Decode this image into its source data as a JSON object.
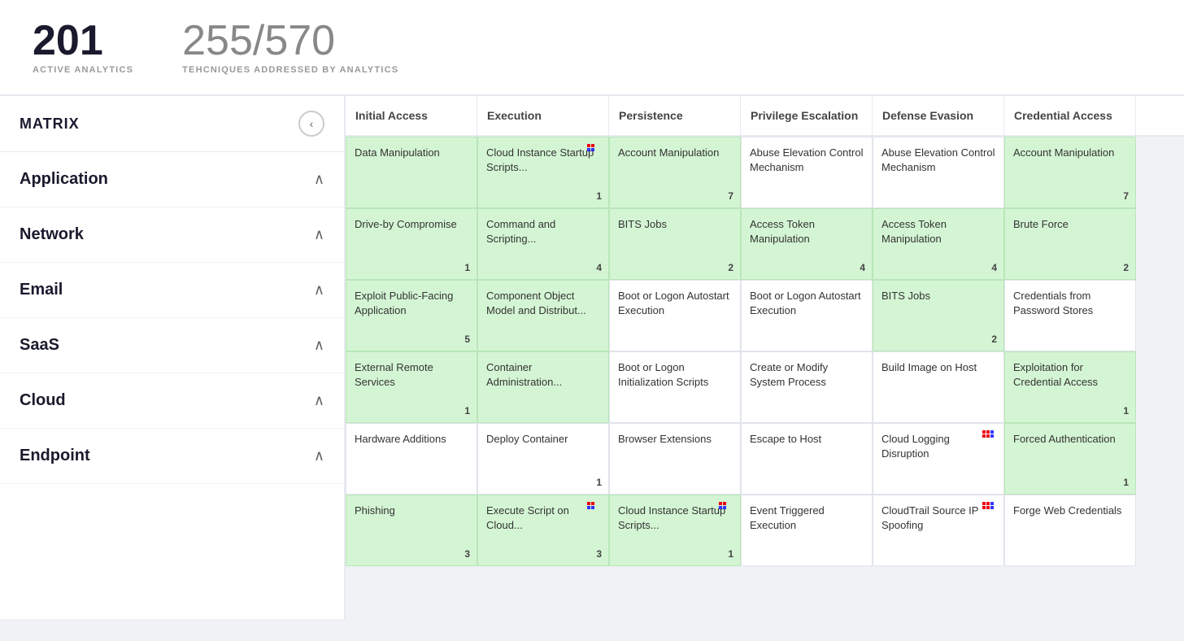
{
  "topbar": {
    "active_analytics": "201",
    "active_analytics_label": "ACTIVE ANALYTICS",
    "techniques_count": "255",
    "techniques_total": "/570",
    "techniques_label": "TEHCNIQUES ADDRESSED BY ANALYTICS"
  },
  "sidebar": {
    "title": "MATRIX",
    "items": [
      {
        "label": "Application"
      },
      {
        "label": "Network"
      },
      {
        "label": "Email"
      },
      {
        "label": "SaaS"
      },
      {
        "label": "Cloud"
      },
      {
        "label": "Endpoint"
      }
    ]
  },
  "matrix": {
    "columns": [
      "Initial Access",
      "Execution",
      "Persistence",
      "Privilege Escalation",
      "Defense Evasion",
      "Credential Access"
    ],
    "rows": [
      [
        {
          "text": "Data Manipulation",
          "style": "green",
          "badge": "",
          "icon": false
        },
        {
          "text": "Cloud Instance Startup Scripts...",
          "style": "green",
          "badge": "1",
          "icon": true,
          "icon_type": "mixed"
        },
        {
          "text": "Account Manipulation",
          "style": "green",
          "badge": "7",
          "icon": false
        },
        {
          "text": "Abuse Elevation Control Mechanism",
          "style": "",
          "badge": "",
          "icon": false
        },
        {
          "text": "Abuse Elevation Control Mechanism",
          "style": "",
          "badge": "",
          "icon": false
        },
        {
          "text": "Account Manipulation",
          "style": "green",
          "badge": "7",
          "icon": false
        }
      ],
      [
        {
          "text": "Drive-by Compromise",
          "style": "green",
          "badge": "1",
          "icon": false
        },
        {
          "text": "Command and Scripting...",
          "style": "green",
          "badge": "4",
          "icon": false
        },
        {
          "text": "BITS Jobs",
          "style": "green",
          "badge": "2",
          "icon": false
        },
        {
          "text": "Access Token Manipulation",
          "style": "green",
          "badge": "4",
          "icon": false
        },
        {
          "text": "Access Token Manipulation",
          "style": "green",
          "badge": "4",
          "icon": false
        },
        {
          "text": "Brute Force",
          "style": "green",
          "badge": "2",
          "icon": false
        }
      ],
      [
        {
          "text": "Exploit Public-Facing Application",
          "style": "green",
          "badge": "5",
          "icon": false
        },
        {
          "text": "Component Object Model and Distribut...",
          "style": "green",
          "badge": "",
          "icon": false
        },
        {
          "text": "Boot or Logon Autostart Execution",
          "style": "",
          "badge": "",
          "icon": false
        },
        {
          "text": "Boot or Logon Autostart Execution",
          "style": "",
          "badge": "",
          "icon": false
        },
        {
          "text": "BITS Jobs",
          "style": "green",
          "badge": "2",
          "icon": false
        },
        {
          "text": "Credentials from Password Stores",
          "style": "",
          "badge": "",
          "icon": false
        }
      ],
      [
        {
          "text": "External Remote Services",
          "style": "green",
          "badge": "1",
          "icon": false
        },
        {
          "text": "Container Administration...",
          "style": "green",
          "badge": "",
          "icon": false
        },
        {
          "text": "Boot or Logon Initialization Scripts",
          "style": "",
          "badge": "",
          "icon": false
        },
        {
          "text": "Create or Modify System Process",
          "style": "",
          "badge": "",
          "icon": false
        },
        {
          "text": "Build Image on Host",
          "style": "",
          "badge": "",
          "icon": false
        },
        {
          "text": "Exploitation for Credential Access",
          "style": "green",
          "badge": "1",
          "icon": false
        }
      ],
      [
        {
          "text": "Hardware Additions",
          "style": "",
          "badge": "",
          "icon": false
        },
        {
          "text": "Deploy Container",
          "style": "",
          "badge": "1",
          "icon": false
        },
        {
          "text": "Browser Extensions",
          "style": "",
          "badge": "",
          "icon": false
        },
        {
          "text": "Escape to Host",
          "style": "",
          "badge": "",
          "icon": false
        },
        {
          "text": "Cloud Logging Disruption",
          "style": "",
          "badge": "",
          "icon": true,
          "icon_type": "red"
        },
        {
          "text": "Forced Authentication",
          "style": "green",
          "badge": "1",
          "icon": false
        }
      ],
      [
        {
          "text": "Phishing",
          "style": "green",
          "badge": "3",
          "icon": false
        },
        {
          "text": "Execute Script on Cloud...",
          "style": "green",
          "badge": "3",
          "icon": true,
          "icon_type": "mixed"
        },
        {
          "text": "Cloud Instance Startup Scripts...",
          "style": "green",
          "badge": "1",
          "icon": true,
          "icon_type": "mixed"
        },
        {
          "text": "Event Triggered Execution",
          "style": "",
          "badge": "",
          "icon": false
        },
        {
          "text": "CloudTrail Source IP Spoofing",
          "style": "",
          "badge": "",
          "icon": true,
          "icon_type": "red"
        },
        {
          "text": "Forge Web Credentials",
          "style": "",
          "badge": "",
          "icon": false
        }
      ]
    ]
  }
}
